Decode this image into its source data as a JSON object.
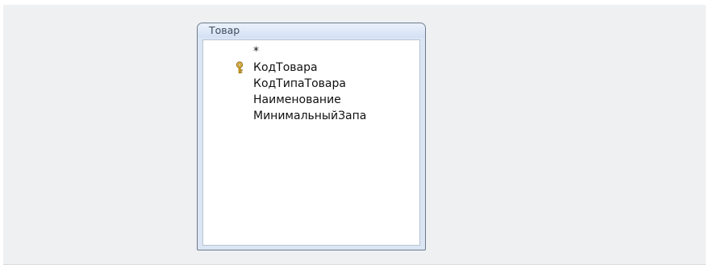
{
  "table": {
    "title": "Товар",
    "fields": [
      {
        "label": "*",
        "primary_key": false
      },
      {
        "label": "КодТовара",
        "primary_key": true,
        "icon": "key-icon"
      },
      {
        "label": "КодТипаТовара",
        "primary_key": false
      },
      {
        "label": "Наименование",
        "primary_key": false
      },
      {
        "label": "МинимальныйЗапа",
        "primary_key": false
      }
    ]
  },
  "colors": {
    "canvas": "#eff0f2",
    "title_bar": "#d3e1f3",
    "border": "#6f7a8a",
    "key_gold": "#d4a21a"
  }
}
